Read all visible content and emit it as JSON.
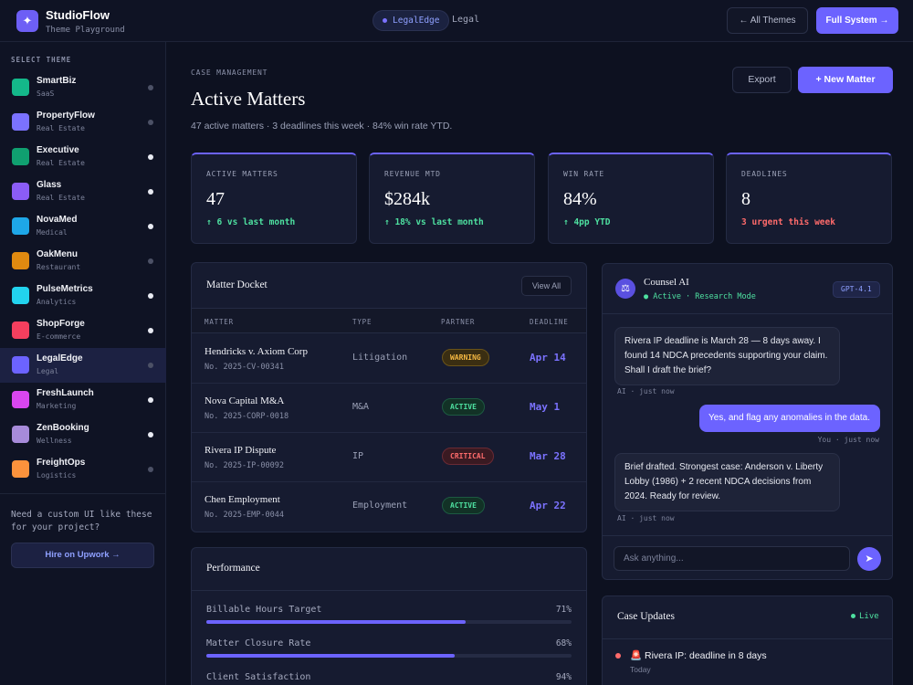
{
  "app": {
    "name": "StudioFlow",
    "subtitle": "Theme Playground"
  },
  "topbar": {
    "current_theme": "LegalEdge",
    "current_category": "Legal",
    "all_themes_label": "← All Themes",
    "full_system_label": "Full System →"
  },
  "sidebar": {
    "heading": "SELECT THEME",
    "items": [
      {
        "name": "SmartBiz",
        "category": "SaaS",
        "color": "#14b88a",
        "active": false
      },
      {
        "name": "PropertyFlow",
        "category": "Real Estate",
        "color": "#7b72ff",
        "active": false
      },
      {
        "name": "Executive",
        "category": "Real Estate",
        "color": "#10a070",
        "active": false
      },
      {
        "name": "Glass",
        "category": "Real Estate",
        "color": "#8b5cf6",
        "active": false
      },
      {
        "name": "NovaMed",
        "category": "Medical",
        "color": "#1ea7e8",
        "active": false
      },
      {
        "name": "OakMenu",
        "category": "Restaurant",
        "color": "#e08a10",
        "active": false
      },
      {
        "name": "PulseMetrics",
        "category": "Analytics",
        "color": "#22d3ee",
        "active": false
      },
      {
        "name": "ShopForge",
        "category": "E-commerce",
        "color": "#f43f5e",
        "active": false
      },
      {
        "name": "LegalEdge",
        "category": "Legal",
        "color": "#6c63ff",
        "active": true
      },
      {
        "name": "FreshLaunch",
        "category": "Marketing",
        "color": "#d946ef",
        "active": false
      },
      {
        "name": "ZenBooking",
        "category": "Wellness",
        "color": "#a78bda",
        "active": false
      },
      {
        "name": "FreightOps",
        "category": "Logistics",
        "color": "#fb923c",
        "active": false
      }
    ],
    "promo_text": "Need a custom UI like these for your project?",
    "hire_label": "Hire on Upwork →"
  },
  "main": {
    "eyebrow": "CASE MANAGEMENT",
    "title": "Active Matters",
    "subtitle": "47 active matters · 3 deadlines this week · 84% win rate YTD.",
    "export_label": "Export",
    "new_label": "+ New Matter",
    "stats": [
      {
        "label": "ACTIVE MATTERS",
        "value": "47",
        "delta": "↑ 6 vs last month",
        "delta_color": "#4ee0a0"
      },
      {
        "label": "REVENUE MTD",
        "value": "$284k",
        "delta": "↑ 18% vs last month",
        "delta_color": "#4ee0a0"
      },
      {
        "label": "WIN RATE",
        "value": "84%",
        "delta": "↑ 4pp YTD",
        "delta_color": "#4ee0a0"
      },
      {
        "label": "DEADLINES",
        "value": "8",
        "delta": "3 urgent this week",
        "delta_color": "#ff6b6b"
      }
    ]
  },
  "docket": {
    "title": "Matter Docket",
    "view_all": "View All",
    "columns": {
      "matter": "MATTER",
      "type": "TYPE",
      "partner": "PARTNER",
      "deadline": "DEADLINE"
    },
    "rows": [
      {
        "name": "Hendricks v. Axiom Corp",
        "number": "No. 2025-CV-00341",
        "type": "Litigation",
        "status": "WARNING",
        "deadline": "Apr 14"
      },
      {
        "name": "Nova Capital M&A",
        "number": "No. 2025-CORP-0018",
        "type": "M&A",
        "status": "ACTIVE",
        "deadline": "May 1"
      },
      {
        "name": "Rivera IP Dispute",
        "number": "No. 2025-IP-00092",
        "type": "IP",
        "status": "CRITICAL",
        "deadline": "Mar 28"
      },
      {
        "name": "Chen Employment",
        "number": "No. 2025-EMP-0044",
        "type": "Employment",
        "status": "ACTIVE",
        "deadline": "Apr 22"
      }
    ],
    "status_colors": {
      "WARNING": {
        "fg": "#f5b842",
        "bg": "#3a2e12",
        "border": "#6b5418"
      },
      "ACTIVE": {
        "fg": "#4ee0a0",
        "bg": "#123226",
        "border": "#1d5a42"
      },
      "CRITICAL": {
        "fg": "#ff6b6b",
        "bg": "#3a1a22",
        "border": "#6a2a34"
      }
    }
  },
  "performance": {
    "title": "Performance",
    "bars": [
      {
        "label": "Billable Hours Target",
        "value": 71,
        "display": "71%"
      },
      {
        "label": "Matter Closure Rate",
        "value": 68,
        "display": "68%"
      },
      {
        "label": "Client Satisfaction",
        "value": 94,
        "display": "94%"
      }
    ]
  },
  "assistant": {
    "name": "Counsel AI",
    "status": "● Active · Research Mode",
    "model": "GPT-4.1",
    "messages": [
      {
        "from": "ai",
        "text": "Rivera IP deadline is March 28 — 8 days away. I found 14 NDCA precedents supporting your claim. Shall I draft the brief?",
        "meta": "AI · just now"
      },
      {
        "from": "user",
        "text": "Yes, and flag any anomalies in the data.",
        "meta": "You · just now"
      },
      {
        "from": "ai",
        "text": "Brief drafted. Strongest case: Anderson v. Liberty Lobby (1986) + 2 recent NDCA decisions from 2024. Ready for review.",
        "meta": "AI · just now"
      }
    ],
    "input_placeholder": "Ask anything..."
  },
  "updates": {
    "title": "Case Updates",
    "live_label": "Live",
    "items": [
      {
        "text": "🚨 Rivera IP: deadline in 8 days",
        "time": "Today"
      }
    ]
  }
}
